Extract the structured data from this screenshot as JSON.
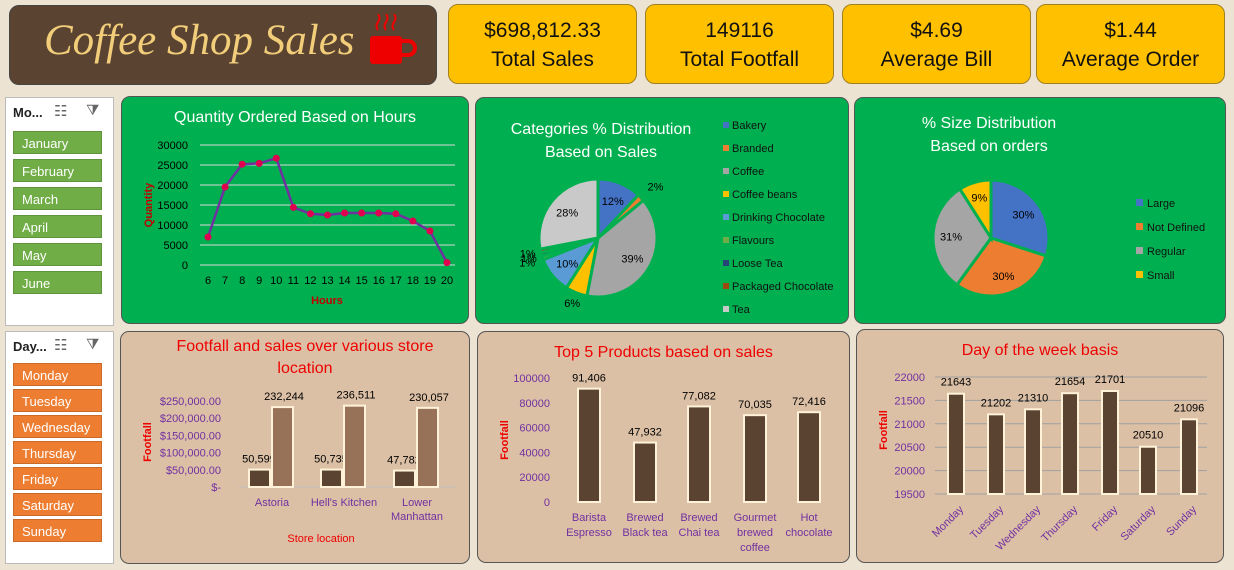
{
  "header": {
    "title": "Coffee Shop Sales",
    "icon": "coffee-cup-icon"
  },
  "kpis": [
    {
      "value": "$698,812.33",
      "label": "Total Sales"
    },
    {
      "value": "149116",
      "label": "Total Footfall"
    },
    {
      "value": "$4.69",
      "label": "Average Bill"
    },
    {
      "value": "$1.44",
      "label": "Average Order"
    }
  ],
  "month_slicer": {
    "header": "Mo...",
    "items": [
      "January",
      "February",
      "March",
      "April",
      "May",
      "June"
    ]
  },
  "day_slicer": {
    "header": "Day...",
    "items": [
      "Monday",
      "Tuesday",
      "Wednesday",
      "Thursday",
      "Friday",
      "Saturday",
      "Sunday"
    ]
  },
  "colors": {
    "green_panel": "#00b050",
    "tan_panel": "#dcc0a6",
    "kpi": "#ffc000",
    "bar": "#5a4431",
    "title_bg": "#5a4431"
  },
  "chart_data": [
    {
      "type": "line",
      "title": "Quantity Ordered Based on Hours",
      "xlabel": "Hours",
      "ylabel": "Quantity",
      "x": [
        6,
        7,
        8,
        9,
        10,
        11,
        12,
        13,
        14,
        15,
        16,
        17,
        18,
        19,
        20
      ],
      "values": [
        7000,
        19500,
        25200,
        25400,
        26700,
        14400,
        12800,
        12500,
        13000,
        13000,
        13000,
        12800,
        11000,
        8500,
        600
      ],
      "ylim": [
        0,
        30000
      ],
      "yticks": [
        "30000",
        "25000",
        "20000",
        "15000",
        "10000",
        "5000",
        "0"
      ],
      "xtick_labels": [
        "6",
        "7",
        "8",
        "9",
        "10",
        "11",
        "12",
        "13",
        "14",
        "15",
        "16",
        "17",
        "18",
        "19",
        "20"
      ]
    },
    {
      "type": "pie",
      "title_lines": [
        "Categories % Distribution",
        "Based on Sales"
      ],
      "legend": [
        "Bakery",
        "Branded",
        "Coffee",
        "Coffee beans",
        "Drinking Chocolate",
        "Flavours",
        "Loose Tea",
        "Packaged Chocolate",
        "Tea"
      ],
      "values": [
        12,
        2,
        39,
        6,
        10,
        1,
        1,
        1,
        28
      ],
      "labels": [
        "12%",
        "2%",
        "39%",
        "6%",
        "10%",
        "1%",
        "1%",
        "1%",
        "28%"
      ],
      "colors": [
        "#4472c4",
        "#ed7d31",
        "#a5a5a5",
        "#ffc000",
        "#5b9bd5",
        "#70ad47",
        "#264478",
        "#9e480e",
        "#c9c9c9"
      ]
    },
    {
      "type": "pie",
      "title_lines": [
        "% Size Distribution",
        "Based on orders"
      ],
      "legend": [
        "Large",
        "Not Defined",
        "Regular",
        "Small"
      ],
      "values": [
        30,
        30,
        31,
        9
      ],
      "labels": [
        "30%",
        "30%",
        "31%",
        "9%"
      ],
      "colors": [
        "#4472c4",
        "#ed7d31",
        "#a5a5a5",
        "#ffc000"
      ]
    },
    {
      "type": "bar",
      "title_lines": [
        "Footfall and sales over various store",
        "location"
      ],
      "xlabel": "Store location",
      "ylabel": "Footfall",
      "categories": [
        "Astoria",
        "Hell's Kitchen",
        "Lower Manhattan"
      ],
      "category_lines": [
        [
          "Astoria"
        ],
        [
          "Hell's Kitchen"
        ],
        [
          "Lower",
          "Manhattan"
        ]
      ],
      "series": [
        {
          "values": [
            50599,
            50735,
            47782
          ],
          "labels": [
            "50,599",
            "50,735",
            "47,782"
          ],
          "color": "#5a4431"
        },
        {
          "values": [
            232244,
            236511,
            230057
          ],
          "labels": [
            "232,244",
            "236,511",
            "230,057"
          ],
          "color": "#977158"
        }
      ],
      "ylim": [
        0,
        250000
      ],
      "yticks": [
        "$250,000.00",
        "$200,000.00",
        "$150,000.00",
        "$100,000.00",
        "$50,000.00",
        "$-"
      ]
    },
    {
      "type": "bar",
      "title": "Top 5 Products based on sales",
      "ylabel": "Footfall",
      "categories": [
        "Barista Espresso",
        "Brewed Black tea",
        "Brewed Chai tea",
        "Gourmet brewed coffee",
        "Hot chocolate"
      ],
      "category_lines": [
        [
          "Barista",
          "Espresso"
        ],
        [
          "Brewed",
          "Black tea"
        ],
        [
          "Brewed",
          "Chai tea"
        ],
        [
          "Gourmet",
          "brewed",
          "coffee"
        ],
        [
          "Hot",
          "chocolate"
        ]
      ],
      "values": [
        91406,
        47932,
        77082,
        70035,
        72416
      ],
      "labels": [
        "91,406",
        "47,932",
        "77,082",
        "70,035",
        "72,416"
      ],
      "ylim": [
        0,
        100000
      ],
      "yticks": [
        "100000",
        "80000",
        "60000",
        "40000",
        "20000",
        "0"
      ]
    },
    {
      "type": "bar",
      "title": "Day of the week basis",
      "ylabel": "Footfall",
      "categories": [
        "Monday",
        "Tuesday",
        "Wednesday",
        "Thursday",
        "Friday",
        "Saturday",
        "Sunday"
      ],
      "values": [
        21643,
        21202,
        21310,
        21654,
        21701,
        20510,
        21096
      ],
      "labels": [
        "21643",
        "21202",
        "21310",
        "21654",
        "21701",
        "20510",
        "21096"
      ],
      "ylim": [
        19500,
        22000
      ],
      "yticks": [
        "22000",
        "21500",
        "21000",
        "20500",
        "20000",
        "19500"
      ]
    }
  ]
}
